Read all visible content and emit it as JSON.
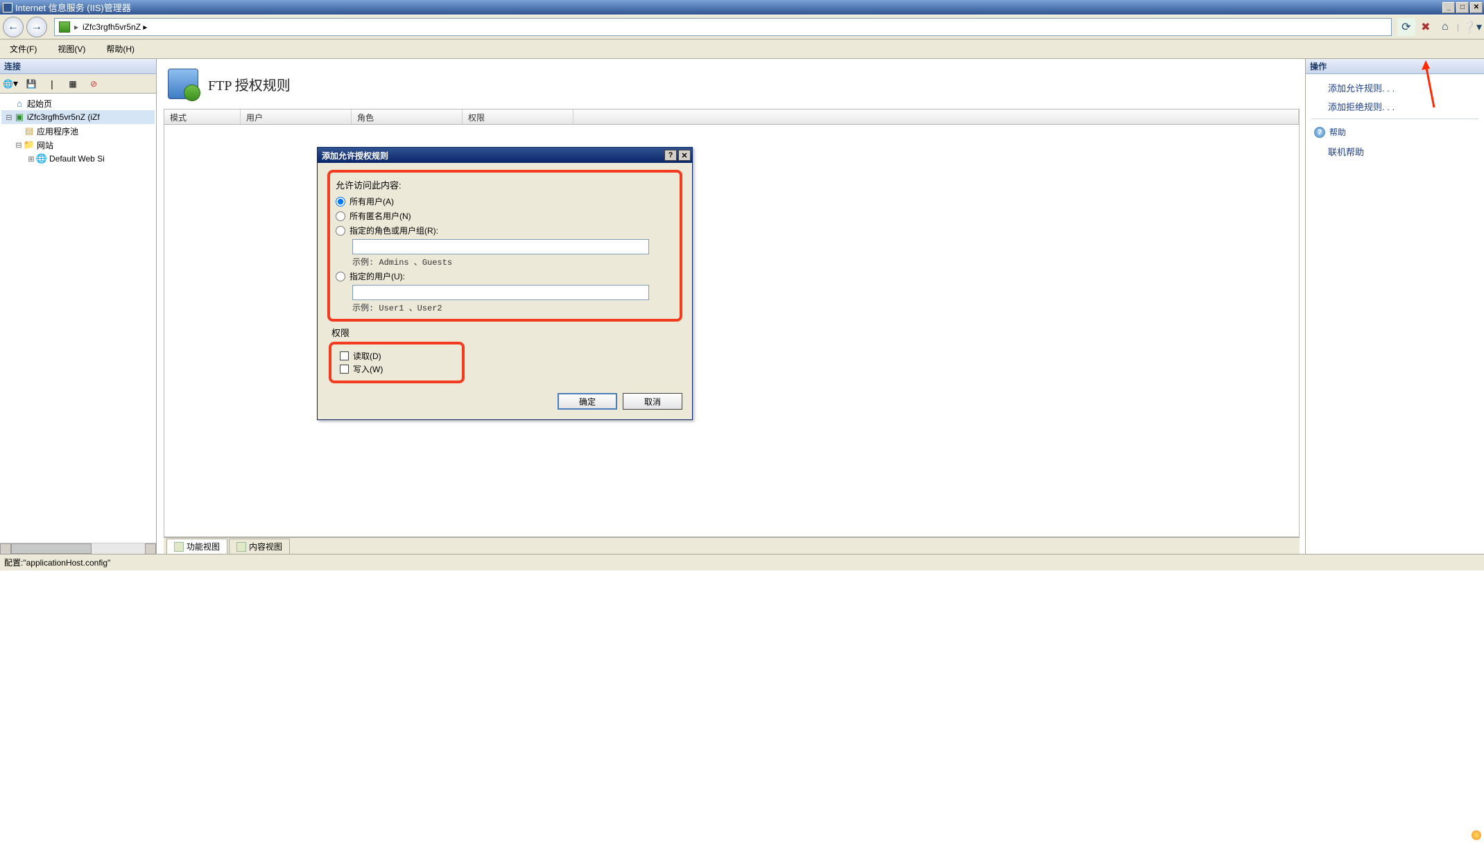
{
  "window": {
    "title": "Internet 信息服务 (IIS)管理器",
    "min": "_",
    "max": "□",
    "close": "✕"
  },
  "nav": {
    "back": "←",
    "fwd": "→",
    "path1": "iZfc3rgfh5vr5nZ  ▸",
    "chev": "▸"
  },
  "menu": {
    "file": "文件(F)",
    "view": "视图(V)",
    "help": "帮助(H)"
  },
  "connections": {
    "header": "连接",
    "toolbar": {
      "world": "🌐",
      "save": "💾",
      "sep": "|",
      "grid": "▦",
      "del": "⊘"
    },
    "tree": {
      "start": "起始页",
      "server": "iZfc3rgfh5vr5nZ (iZf",
      "apppools": "应用程序池",
      "sites": "网站",
      "default": "Default Web Si"
    }
  },
  "main": {
    "title": "FTP 授权规则",
    "columns": {
      "c1": "模式",
      "c2": "用户",
      "c3": "角色",
      "c4": "权限"
    }
  },
  "dialog": {
    "title": "添加允许授权规则",
    "help": "?",
    "close": "✕",
    "section1": "允许访问此内容:",
    "opt_all": "所有用户(A)",
    "opt_anon": "所有匿名用户(N)",
    "opt_roles": "指定的角色或用户组(R):",
    "hint_roles": "示例: Admins 、Guests",
    "opt_users": "指定的用户(U):",
    "hint_users": "示例: User1 、User2",
    "section2": "权限",
    "chk_read": "读取(D)",
    "chk_write": "写入(W)",
    "ok": "确定",
    "cancel": "取消"
  },
  "tabs": {
    "features": "功能视图",
    "content": "内容视图"
  },
  "actions": {
    "header": "操作",
    "add_allow": "添加允许规则. . .",
    "add_deny": "添加拒绝规则. . .",
    "help": "帮助",
    "online": "联机帮助"
  },
  "status": {
    "text": "配置:\"applicationHost.config\""
  }
}
